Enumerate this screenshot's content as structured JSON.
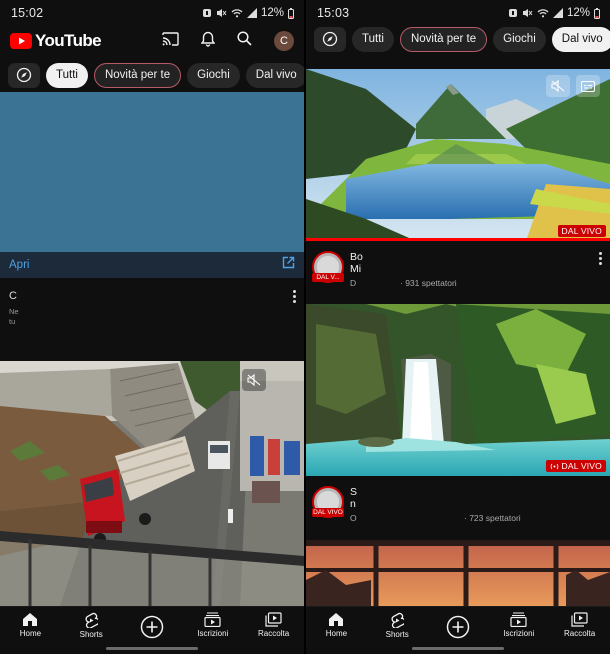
{
  "left": {
    "status": {
      "time": "15:02",
      "battery": "12%"
    },
    "header": {
      "logo_text": "YouTube",
      "avatar_letter": "C"
    },
    "chips": [
      "Tutti",
      "Novità per te",
      "Giochi",
      "Dal vivo"
    ],
    "ad": {
      "open_label": "Apri",
      "title_fragment": "C",
      "desc_line1": "Ne",
      "desc_line2": "tu"
    }
  },
  "right": {
    "status": {
      "time": "15:03",
      "battery": "12%"
    },
    "chips": [
      "Tutti",
      "Novità per te",
      "Giochi",
      "Dal vivo"
    ],
    "videos": [
      {
        "title_line1": "Bo",
        "title_line2": "Mi",
        "channel": "D",
        "viewers": "· 931 spettatori",
        "live_badge": "DAL VIVO",
        "avatar_badge": "DAL V..."
      },
      {
        "title_line1": "S",
        "title_line2": "n",
        "channel": "O",
        "viewers": "· 723 spettatori",
        "live_badge": "DAL VIVO",
        "avatar_badge": "DAL VIVO"
      }
    ]
  },
  "bottom_nav": {
    "items": [
      {
        "label": "Home",
        "icon": "home-icon"
      },
      {
        "label": "Shorts",
        "icon": "shorts-icon"
      },
      {
        "label": "",
        "icon": "create-icon"
      },
      {
        "label": "Iscrizioni",
        "icon": "subscriptions-icon"
      },
      {
        "label": "Raccolta",
        "icon": "library-icon"
      }
    ]
  },
  "colors": {
    "brand_red": "#ff0000",
    "live_red": "#cc0000",
    "link_blue": "#4ea2e6",
    "background": "#0f0f0f"
  }
}
